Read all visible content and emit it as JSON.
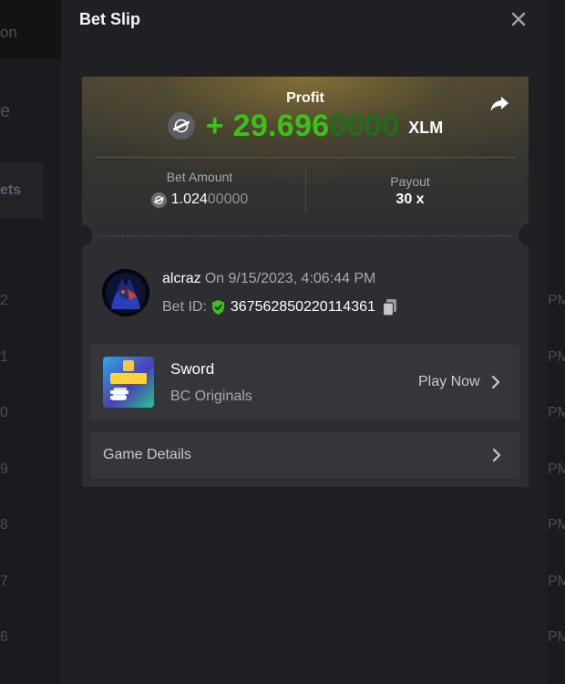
{
  "background": {
    "left_items": [
      "on",
      "e"
    ],
    "left_tab": "ets",
    "left_row_numbers": [
      "2",
      "1",
      "0",
      "9",
      "8",
      "7",
      "6"
    ],
    "right_time_suffix": [
      "PM",
      "PM",
      "PM",
      "PM",
      "PM",
      "PM",
      "PM"
    ]
  },
  "modal": {
    "title": "Bet Slip",
    "close_icon": "close-icon"
  },
  "profit": {
    "label": "Profit",
    "sign": "+",
    "amount_main": "29.696",
    "amount_trailing_zeros": "0000",
    "currency": "XLM",
    "color": "#3bc117"
  },
  "bet_amount": {
    "label": "Bet Amount",
    "value_main": "1.024",
    "value_trailing_zeros": "00000"
  },
  "payout": {
    "label": "Payout",
    "value": "30 x"
  },
  "user": {
    "name": "alcraz",
    "date_text": "On 9/15/2023, 4:06:44 PM",
    "bet_id_label": "Bet ID:",
    "bet_id": "367562850220114361"
  },
  "game": {
    "name": "Sword",
    "provider": "BC Originals",
    "play_label": "Play Now"
  },
  "details": {
    "label": "Game Details"
  },
  "icons": {
    "share": "share-icon",
    "currency": "stellar-xlm-icon",
    "verified": "shield-check-icon",
    "copy": "copy-icon",
    "chevron": "chevron-right-icon"
  }
}
